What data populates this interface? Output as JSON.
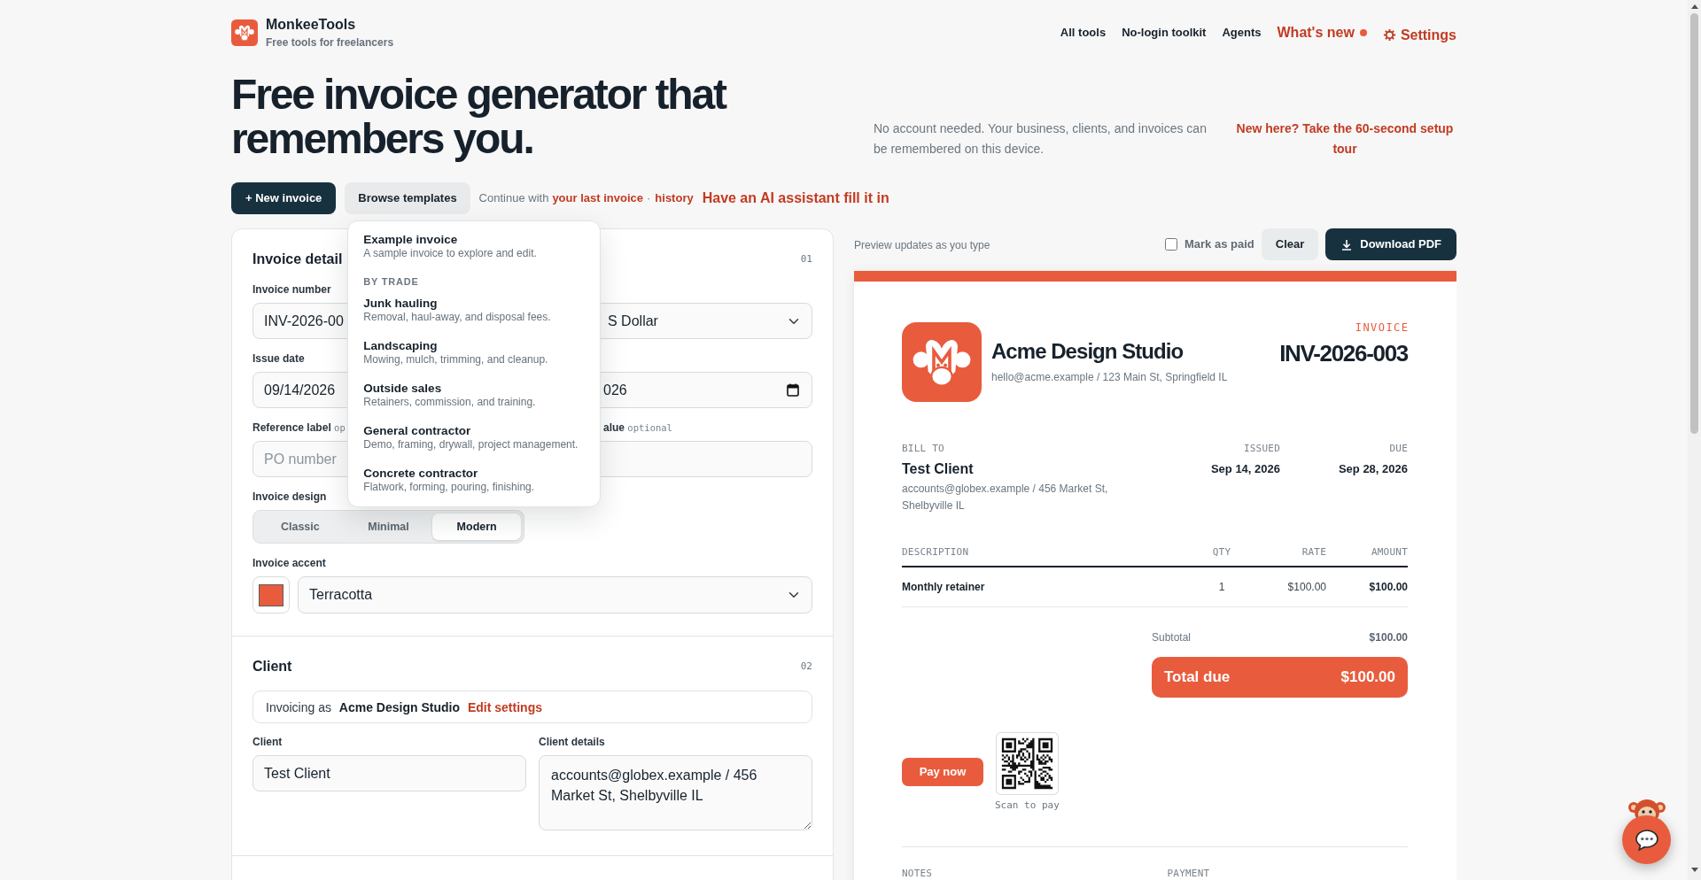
{
  "brand": {
    "name": "MonkeeTools",
    "tagline": "Free tools for freelancers"
  },
  "nav": [
    {
      "label": "All tools",
      "kind": "link"
    },
    {
      "label": "No-login toolkit",
      "kind": "link"
    },
    {
      "label": "Agents",
      "kind": "link"
    },
    {
      "label": "What's new",
      "kind": "news"
    },
    {
      "label": "Settings",
      "kind": "settings"
    }
  ],
  "hero": {
    "title": "Free invoice generator that remembers you.",
    "note": "No account needed. Your business, clients, and invoices can be remembered on this device.",
    "tour_link": "New here? Take the 60-second setup tour"
  },
  "actions": {
    "new_invoice": "+ New invoice",
    "browse_templates": "Browse templates",
    "continue_text": "Continue with",
    "last_invoice_link": "your last invoice",
    "separator": "·",
    "history_link": "history",
    "ai_link": "Have an AI assistant fill it in"
  },
  "templates_menu": {
    "open": true,
    "items": [
      {
        "kind": "template",
        "title": "Example invoice",
        "description": "A sample invoice to explore and edit."
      },
      {
        "kind": "heading",
        "title": "BY TRADE"
      },
      {
        "kind": "template",
        "title": "Junk hauling",
        "description": "Removal, haul-away, and disposal fees."
      },
      {
        "kind": "template",
        "title": "Landscaping",
        "description": "Mowing, mulch, trimming, and cleanup."
      },
      {
        "kind": "template",
        "title": "Outside sales",
        "description": "Retainers, commission, and training."
      },
      {
        "kind": "template",
        "title": "General contractor",
        "description": "Demo, framing, drywall, project management."
      },
      {
        "kind": "template",
        "title": "Concrete contractor",
        "description": "Flatwork, forming, pouring, finishing."
      }
    ]
  },
  "editor": {
    "invoice_details": {
      "title": "Invoice detail",
      "step": "01",
      "invoice_number": {
        "label": "Invoice number",
        "value": "INV-2026-00"
      },
      "currency": {
        "value": "S Dollar"
      },
      "issue_date": {
        "label": "Issue date",
        "value": "09/14/2026"
      },
      "due_date": {
        "value": "026"
      },
      "reference_label": {
        "label": "Reference label",
        "hint": "op",
        "placeholder": "PO number"
      },
      "reference_value": {
        "label": "alue",
        "hint": "optional"
      },
      "design": {
        "label": "Invoice design",
        "options": [
          {
            "label": "Classic",
            "selected": false
          },
          {
            "label": "Minimal",
            "selected": false
          },
          {
            "label": "Modern",
            "selected": true
          }
        ]
      },
      "accent": {
        "label": "Invoice accent",
        "value": "Terracotta"
      }
    },
    "client": {
      "title": "Client",
      "step": "02",
      "invoicing_as": "Invoicing as **Acme Design Studio**",
      "edit_link": "Edit settings",
      "client": {
        "label": "Client",
        "value": "Test Client"
      },
      "details": {
        "label": "Client details",
        "value": "accounts@globex.example / 456 Market St, Shelbyville IL"
      }
    }
  },
  "preview": {
    "hint": "Preview updates as you type",
    "mark_paid": {
      "label": "Mark as paid",
      "checked": false
    },
    "clear": "Clear",
    "download": "Download PDF",
    "invoice": {
      "business": {
        "name": "Acme Design Studio",
        "details": "hello@acme.example / 123 Main St, Springfield IL"
      },
      "doc_label": "INVOICE",
      "number": "INV-2026-003",
      "bill_to": {
        "label": "BILL TO",
        "name": "Test Client",
        "details": "accounts@globex.example / 456 Market St, Shelbyville IL"
      },
      "dates": [
        {
          "label": "ISSUED",
          "value": "Sep 14, 2026"
        },
        {
          "label": "DUE",
          "value": "Sep 28, 2026"
        }
      ],
      "table": {
        "columns": [
          "DESCRIPTION",
          "QTY",
          "RATE",
          "AMOUNT"
        ],
        "rows": [
          {
            "cells": [
              "Monthly retainer",
              "1",
              "$100.00",
              "$100.00"
            ]
          }
        ]
      },
      "subtotal": {
        "label": "Subtotal",
        "value": "$100.00"
      },
      "total": {
        "label": "Total due",
        "value": "$100.00"
      },
      "pay_button": "Pay now",
      "qr_caption": "Scan to pay",
      "footer_labels": [
        "NOTES",
        "PAYMENT"
      ]
    }
  }
}
